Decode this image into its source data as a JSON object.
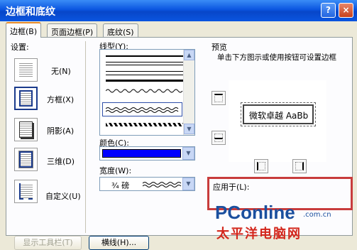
{
  "window": {
    "title": "边框和底纹"
  },
  "tabs": [
    {
      "label": "边框(B)"
    },
    {
      "label": "页面边框(P)"
    },
    {
      "label": "底纹(S)"
    }
  ],
  "settings": {
    "heading": "设置:",
    "items": [
      {
        "label": "无(N)"
      },
      {
        "label": "方框(X)"
      },
      {
        "label": "阴影(A)"
      },
      {
        "label": "三维(D)"
      },
      {
        "label": "自定义(U)"
      }
    ],
    "selected": "方框(X)"
  },
  "line_style": {
    "label": "线型(Y):"
  },
  "color": {
    "label": "颜色(C):",
    "value": "#0000ff"
  },
  "width": {
    "label": "宽度(W):",
    "value": "¾ 磅"
  },
  "preview": {
    "heading": "预览",
    "hint": "单击下方图示或使用按钮可设置边框",
    "sample_text": "微软卓越 AaBb"
  },
  "apply_to": {
    "label": "应用于(L):"
  },
  "footer": {
    "toolbar_button": "显示工具栏(T)",
    "hline_button": "横线(H)..."
  },
  "watermark": {
    "brand": "PConline",
    "domain": ".com.cn",
    "chinese": "太平洋电脑网"
  }
}
